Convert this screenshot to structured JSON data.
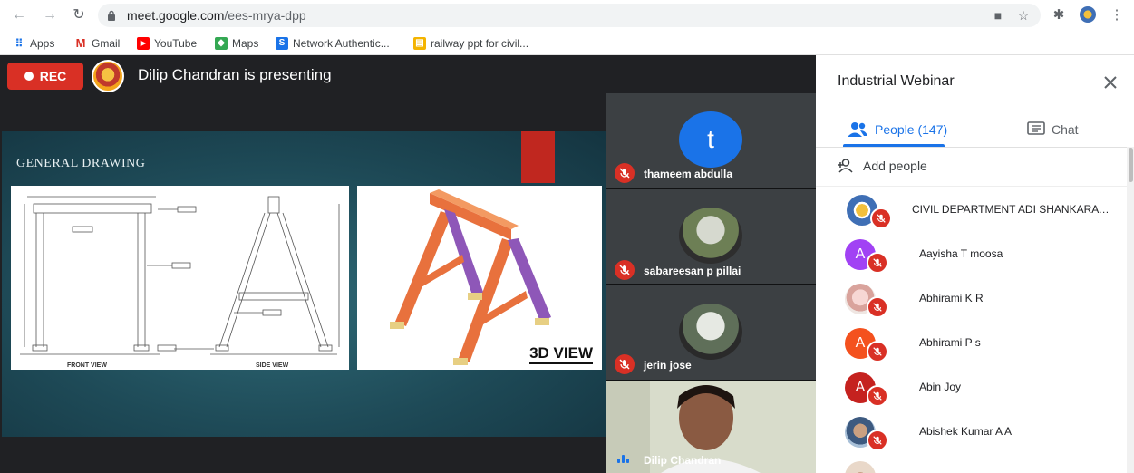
{
  "browser": {
    "url_host": "meet.google.com",
    "url_path": "/ees-mrya-dpp",
    "bookmarks": [
      {
        "label": "Apps",
        "icon": "apps-grid-icon",
        "color": "#1a73e8"
      },
      {
        "label": "Gmail",
        "icon": "gmail-icon",
        "color": "#d93025"
      },
      {
        "label": "YouTube",
        "icon": "youtube-icon",
        "color": "#ff0000"
      },
      {
        "label": "Maps",
        "icon": "maps-icon",
        "color": "#34a853"
      },
      {
        "label": "Network Authentic...",
        "icon": "network-auth-icon",
        "color": "#1a73e8"
      },
      {
        "label": "railway ppt for civil...",
        "icon": "drive-file-icon",
        "color": "#f4b400"
      }
    ]
  },
  "stage": {
    "rec_label": "REC",
    "presenting_text": "Dilip Chandran is presenting",
    "slide": {
      "title": "GENERAL DRAWING",
      "front_view_label": "FRONT VIEW",
      "side_view_label": "SIDE VIEW",
      "view_3d_label": "3D VIEW"
    }
  },
  "tiles": [
    {
      "name": "thameem abdulla",
      "avatar_letter": "t",
      "avatar_color": "#1a73e8",
      "muted": true
    },
    {
      "name": "sabareesan p pillai",
      "avatar_letter": "",
      "avatar_color": "#8fa36a",
      "muted": true
    },
    {
      "name": "jerin jose",
      "avatar_letter": "",
      "avatar_color": "#7a8b75",
      "muted": true
    },
    {
      "name": "Dilip Chandran",
      "avatar_letter": "",
      "avatar_color": "",
      "muted": false,
      "speaking": true
    }
  ],
  "sidebar": {
    "title": "Industrial Webinar",
    "tab_people": "People (147)",
    "tab_chat": "Chat",
    "add_people": "Add people",
    "participants": [
      {
        "name": "CIVIL DEPARTMENT ADI SHANKARA I...",
        "avatar_letter": "",
        "avatar_color": "#3f6fb5"
      },
      {
        "name": "Aayisha T moosa",
        "avatar_letter": "A",
        "avatar_color": "#a142f4"
      },
      {
        "name": "Abhirami K R",
        "avatar_letter": "",
        "avatar_color": "#e8b4b0"
      },
      {
        "name": "Abhirami P s",
        "avatar_letter": "A",
        "avatar_color": "#f4511e"
      },
      {
        "name": "Abin Joy",
        "avatar_letter": "A",
        "avatar_color": "#c5221f"
      },
      {
        "name": "Abishek Kumar A A",
        "avatar_letter": "",
        "avatar_color": "#6d8fb0"
      }
    ]
  }
}
